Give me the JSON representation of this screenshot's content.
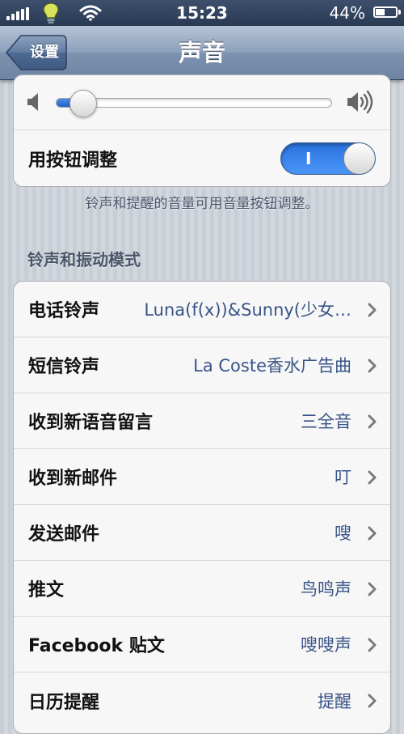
{
  "status_bar": {
    "time": "15:23",
    "battery_text": "44%",
    "battery_level": 0.44
  },
  "nav": {
    "back_label": "设置",
    "title": "声音"
  },
  "volume": {
    "level": 0.1
  },
  "buttons_toggle": {
    "label": "用按钮调整",
    "state_text": "I"
  },
  "footnote": "铃声和提醒的音量可用音量按钮调整。",
  "section_header": "铃声和振动模式",
  "rows": [
    {
      "label": "电话铃声",
      "value": "Luna(f(x))&Sunny(少女…"
    },
    {
      "label": "短信铃声",
      "value": "La Coste香水广告曲"
    },
    {
      "label": "收到新语音留言",
      "value": "三全音"
    },
    {
      "label": "收到新邮件",
      "value": "叮"
    },
    {
      "label": "发送邮件",
      "value": "嗖"
    },
    {
      "label": "推文",
      "value": "鸟鸣声"
    },
    {
      "label": "Facebook 贴文",
      "value": "嗖嗖声"
    },
    {
      "label": "日历提醒",
      "value": "提醒"
    }
  ]
}
